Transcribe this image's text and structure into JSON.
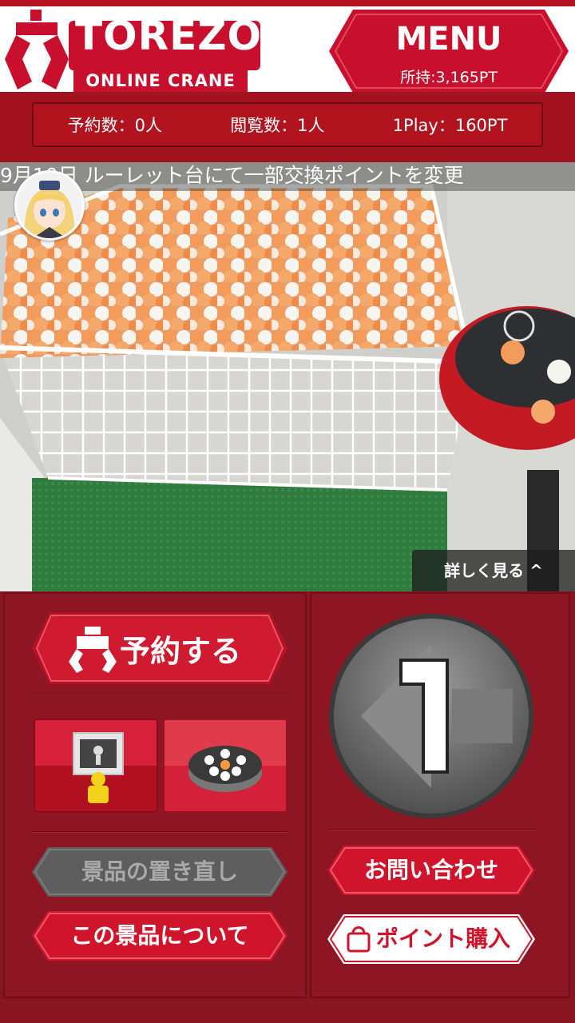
{
  "header": {
    "logo_word": "TOREZO",
    "logo_sub": "ONLINE CRANE",
    "menu_label": "MENU",
    "points": "所持:3,165PT"
  },
  "stats": {
    "reservations": "予約数：0人",
    "viewers": "閲覧数：1人",
    "play_cost": "1Play：160PT"
  },
  "video": {
    "ticker": "9月10日 ルーレット台にて一部交換ポイントを変更",
    "details_label": "詳しく見る ^"
  },
  "controls": {
    "reserve_label": "予約する",
    "reposition_label": "景品の置き直し",
    "about_prize_label": "この景品について",
    "contact_label": "お問い合わせ",
    "buy_points_label": "ポイント購入",
    "play_number": "1"
  },
  "colors": {
    "brand_red": "#c8102e",
    "panel": "#8e1624",
    "disabled_gray": "#5e5e5e"
  }
}
